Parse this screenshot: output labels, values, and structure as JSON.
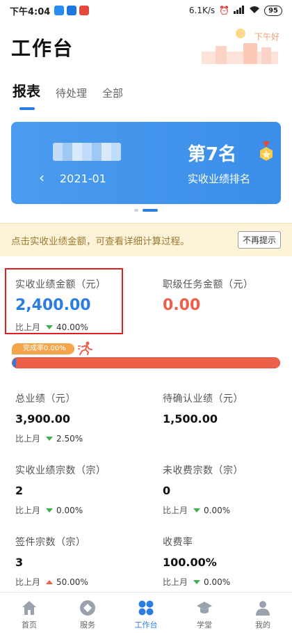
{
  "status_bar": {
    "time": "下午4:04",
    "speed": "6.1K/s",
    "battery": "95"
  },
  "header": {
    "title": "工作台",
    "greeting": "下午好"
  },
  "tabs": [
    {
      "label": "报表",
      "active": true
    },
    {
      "label": "待处理",
      "active": false
    },
    {
      "label": "全部",
      "active": false
    }
  ],
  "banner": {
    "date": "2021-01",
    "rank": "第7名",
    "rank_label": "实收业绩排名"
  },
  "notice": {
    "text": "点击实收业绩金额，可查看详细计算过程。",
    "dismiss_label": "不再提示"
  },
  "metrics": [
    {
      "label": "实收业绩金额（元）",
      "value": "2,400.00",
      "compare_label": "比上月",
      "compare_value": "40.00%",
      "trend": "down"
    },
    {
      "label": "职级任务金额（元）",
      "value": "0.00"
    },
    {
      "label": "总业绩（元）",
      "value": "3,900.00",
      "compare_label": "比上月",
      "compare_value": "2.50%",
      "trend": "down"
    },
    {
      "label": "待确认业绩（元）",
      "value": "1,500.00"
    },
    {
      "label": "实收业绩宗数（宗）",
      "value": "2",
      "compare_label": "比上月",
      "compare_value": "0.00%",
      "trend": "down"
    },
    {
      "label": "未收费宗数（宗）",
      "value": "0",
      "compare_label": "比上月",
      "compare_value": "0.00%",
      "trend": "down"
    },
    {
      "label": "签件宗数（宗）",
      "value": "3",
      "compare_label": "比上月",
      "compare_value": "50.00%",
      "trend": "up"
    },
    {
      "label": "收费率",
      "value": "100.00%",
      "compare_label": "比上月",
      "compare_value": "0.00%",
      "trend": "down"
    }
  ],
  "completion": {
    "label": "完成率0.00%",
    "percent": 0
  },
  "bottom_nav": [
    {
      "label": "首页",
      "icon": "home-icon",
      "active": false
    },
    {
      "label": "服务",
      "icon": "service-icon",
      "active": false
    },
    {
      "label": "工作台",
      "icon": "workbench-icon",
      "active": true
    },
    {
      "label": "学堂",
      "icon": "academy-icon",
      "active": false
    },
    {
      "label": "我的",
      "icon": "profile-icon",
      "active": false
    }
  ],
  "colors": {
    "accent": "#2a7de1",
    "alert": "#ee5f4a",
    "up": "#ee5f4a",
    "down": "#3bb34a",
    "notice_bg": "#fdf3d9"
  }
}
